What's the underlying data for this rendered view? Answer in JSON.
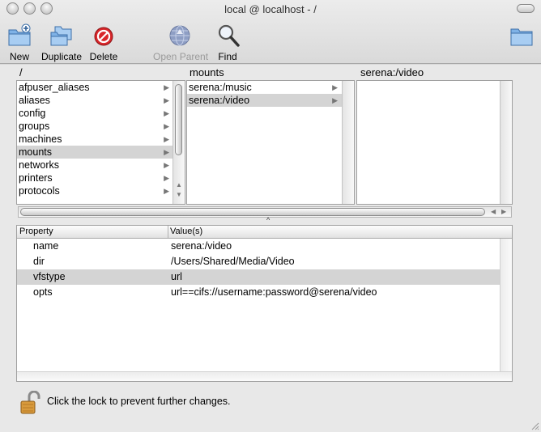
{
  "window": {
    "title": "local @ localhost - /"
  },
  "toolbar": {
    "new": "New",
    "duplicate": "Duplicate",
    "delete": "Delete",
    "open_parent": "Open Parent",
    "find": "Find"
  },
  "browser": {
    "columns": [
      {
        "header": "/",
        "items": [
          "afpuser_aliases",
          "aliases",
          "config",
          "groups",
          "machines",
          "mounts",
          "networks",
          "printers",
          "protocols"
        ],
        "selected": 5
      },
      {
        "header": "mounts",
        "items": [
          "serena:/music",
          "serena:/video"
        ],
        "selected": 1
      },
      {
        "header": "serena:/video",
        "items": []
      }
    ]
  },
  "table": {
    "headers": {
      "property": "Property",
      "values": "Value(s)"
    },
    "rows": [
      {
        "property": "name",
        "value": "serena:/video"
      },
      {
        "property": "dir",
        "value": "/Users/Shared/Media/Video"
      },
      {
        "property": "vfstype",
        "value": "url"
      },
      {
        "property": "opts",
        "value": "url==cifs://username:password@serena/video"
      }
    ],
    "selected_row": 2
  },
  "footer": {
    "lock_text": "Click the lock to prevent further changes."
  }
}
